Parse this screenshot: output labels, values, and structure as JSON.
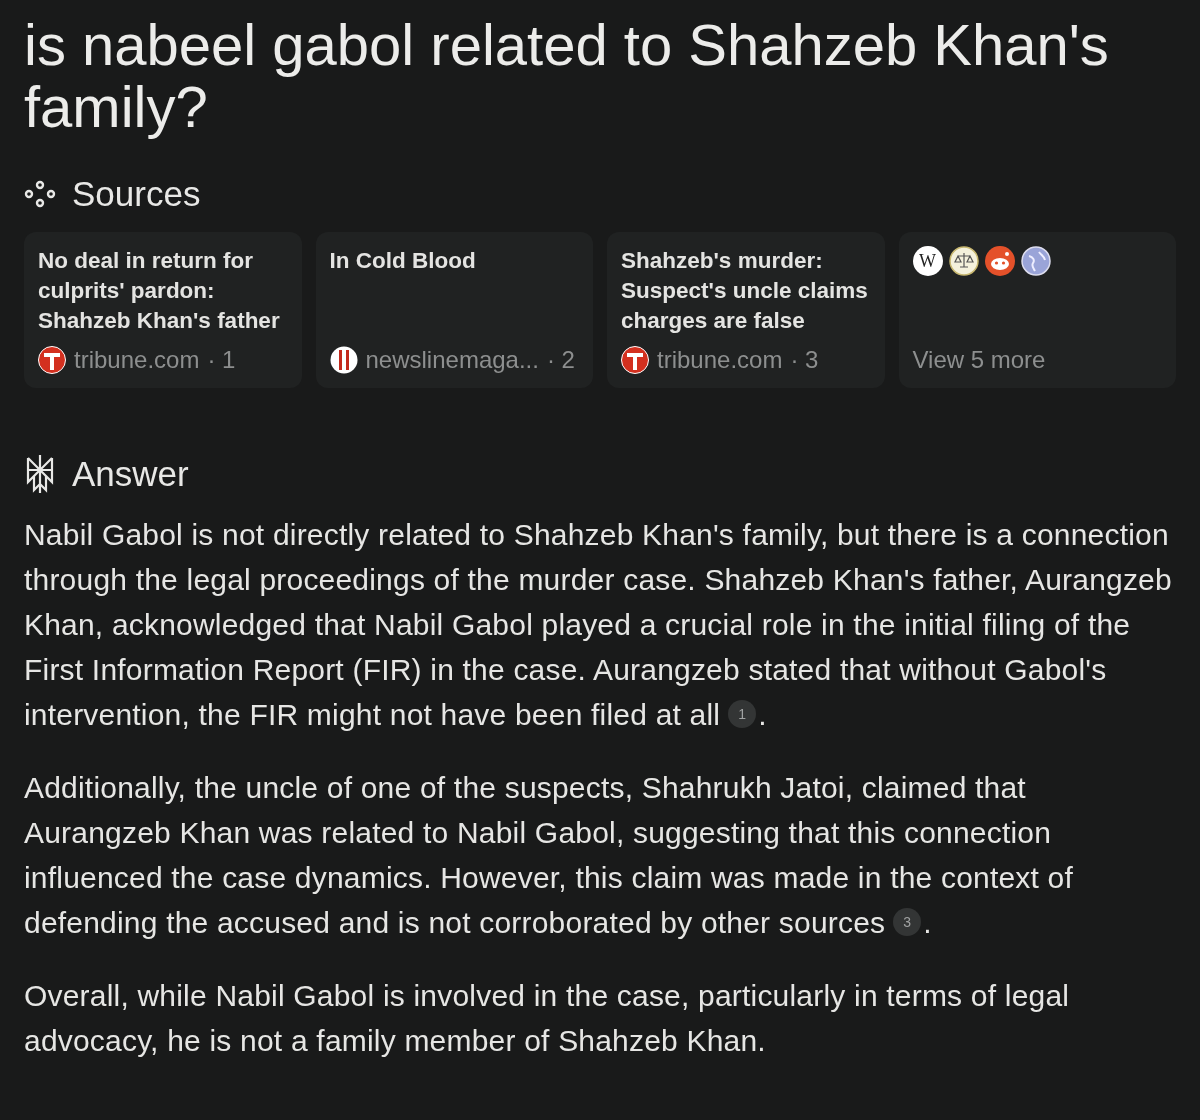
{
  "question": "is nabeel gabol related to Shahzeb Khan's family?",
  "sources": {
    "heading": "Sources",
    "cards": [
      {
        "title": "No deal in return for culprits' pardon: Shahzeb Khan's father",
        "site": "tribune.com",
        "index": "· 1",
        "kind": "tribune"
      },
      {
        "title": "In Cold Blood",
        "site": "newslinemaga...",
        "index": "· 2",
        "kind": "newsline"
      },
      {
        "title": "Shahzeb's murder: Suspect's uncle claims charges are false",
        "site": "tribune.com",
        "index": "· 3",
        "kind": "tribune"
      }
    ],
    "more": {
      "label": "View 5 more",
      "favicons": [
        {
          "kind": "wikipedia",
          "letter": "W"
        },
        {
          "kind": "scales"
        },
        {
          "kind": "reddit"
        },
        {
          "kind": "globe"
        }
      ]
    }
  },
  "answer": {
    "heading": "Answer",
    "paragraphs": [
      {
        "text": "Nabil Gabol is not directly related to Shahzeb Khan's family, but there is a connection through the legal proceedings of the murder case. Shahzeb Khan's father, Aurangzeb Khan, acknowledged that Nabil Gabol played a crucial role in the initial filing of the First Information Report (FIR) in the case. Aurangzeb stated that without Gabol's intervention, the FIR might not have been filed at all",
        "citation": "1",
        "end": "."
      },
      {
        "text": "Additionally, the uncle of one of the suspects, Shahrukh Jatoi, claimed that Aurangzeb Khan was related to Nabil Gabol, suggesting that this connection influenced the case dynamics. However, this claim was made in the context of defending the accused and is not corroborated by other sources",
        "citation": "3",
        "end": "."
      },
      {
        "text": "Overall, while Nabil Gabol is involved in the case, particularly in terms of legal advocacy, he is not a family member of Shahzeb Khan."
      }
    ]
  }
}
